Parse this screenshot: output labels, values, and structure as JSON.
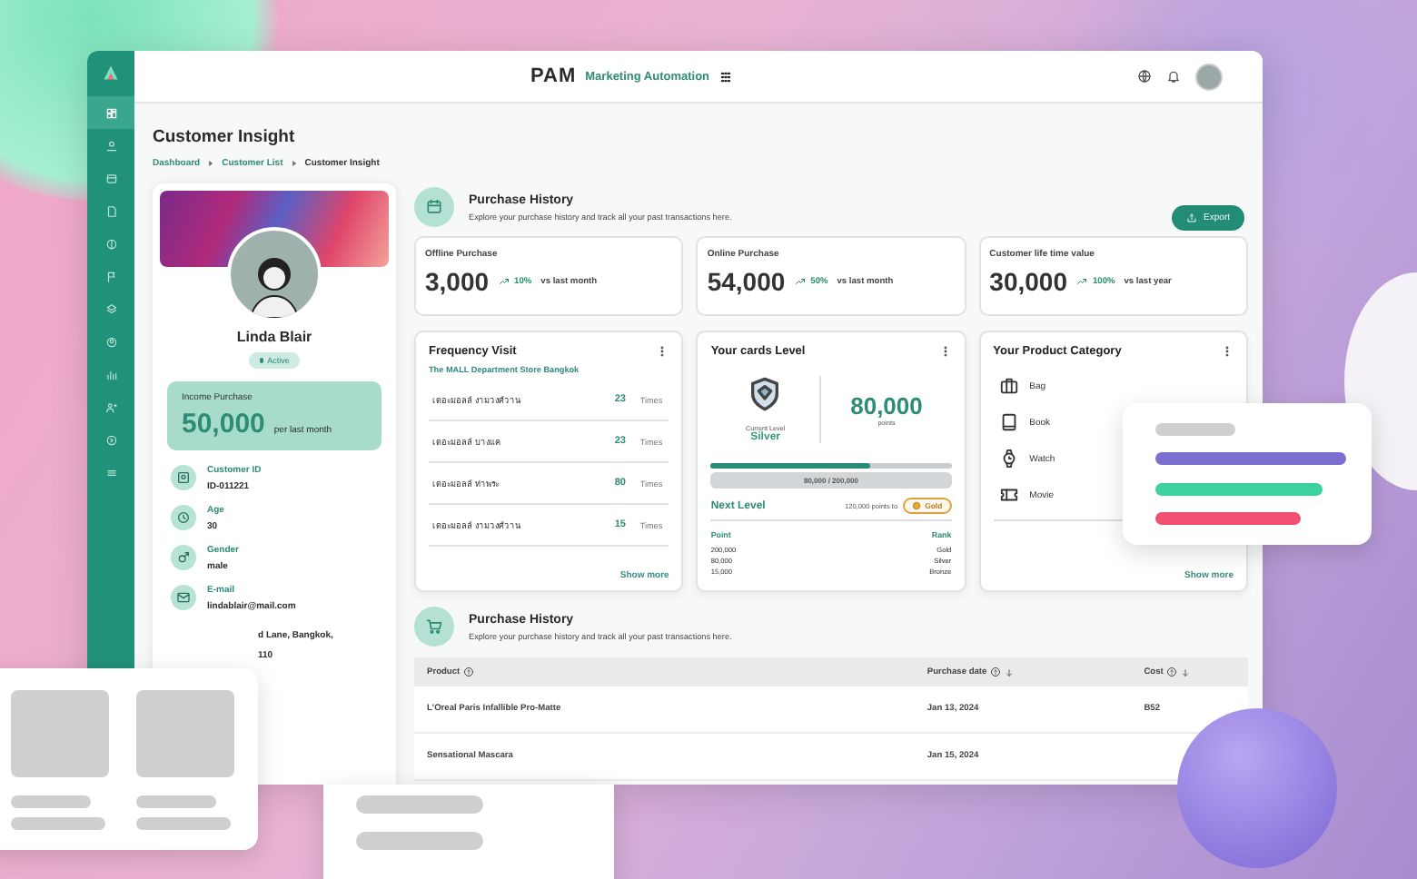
{
  "topbar": {
    "logo": "PAM",
    "product": "Marketing Automation"
  },
  "sidebar": {
    "items": [
      {
        "selected": true
      },
      {
        "selected": false
      },
      {
        "selected": false
      },
      {
        "selected": false
      },
      {
        "selected": false
      },
      {
        "selected": false
      },
      {
        "selected": false
      },
      {
        "selected": false
      },
      {
        "selected": false
      },
      {
        "selected": false
      },
      {
        "selected": false
      },
      {
        "selected": false
      }
    ]
  },
  "page": {
    "title": "Customer Insight",
    "breadcrumb": [
      "Dashboard",
      "Customer List",
      "Customer Insight"
    ]
  },
  "profile": {
    "name": "Linda Blair",
    "status": "Active",
    "active": true,
    "income_label": "Income Purchase",
    "income_value": "50,000",
    "income_period": "per last month",
    "fields": [
      {
        "kind": "id",
        "label": "Customer ID",
        "value": "ID-011221"
      },
      {
        "kind": "age",
        "label": "Age",
        "value": "30"
      },
      {
        "kind": "gender",
        "label": "Gender",
        "value": "male"
      },
      {
        "kind": "email",
        "label": "E-mail",
        "value": "lindablair@mail.com"
      }
    ],
    "address_lines": [
      "d Lane, Bangkok,",
      "110"
    ]
  },
  "summary": {
    "title": "Purchase History",
    "subtitle": "Explore your purchase history and track all your past transactions here.",
    "export": "Export"
  },
  "stats": [
    {
      "label": "Offline Purchase",
      "value": "3,000",
      "change": "10%",
      "compare": "vs last month"
    },
    {
      "label": "Online Purchase",
      "value": "54,000",
      "change": "50%",
      "compare": "vs last month"
    },
    {
      "label": "Customer life time value",
      "value": "30,000",
      "change": "100%",
      "compare": "vs last year"
    }
  ],
  "frequency": {
    "title": "Frequency Visit",
    "store": "The MALL Department Store Bangkok",
    "show_more": "Show more",
    "rows": [
      {
        "name": "เดอะมอลล์ งามวงศ์วาน",
        "count": "23",
        "unit": "Times"
      },
      {
        "name": "เดอะมอลล์ บางแค",
        "count": "23",
        "unit": "Times"
      },
      {
        "name": "เดอะมอลล์ ท่าพระ",
        "count": "80",
        "unit": "Times"
      },
      {
        "name": "เดอะมอลล์ งามวงศ์วาน",
        "count": "15",
        "unit": "Times"
      }
    ]
  },
  "cards_level": {
    "title": "Your cards Level",
    "current_label": "Current Level",
    "current": "Silver",
    "points": "80,000",
    "points_unit": "points",
    "level": 0.66,
    "progress_text": "80,000 / 200,000",
    "next_label": "Next Level",
    "to_next": "120,000 points to",
    "next": "Gold",
    "columns": [
      "Point",
      "Rank"
    ],
    "rows": [
      [
        "200,000",
        "Gold"
      ],
      [
        "80,000",
        "Silver"
      ],
      [
        "15,000",
        "Bronze"
      ]
    ]
  },
  "category": {
    "title": "Your Product Category",
    "show_more": "Show more",
    "items": [
      {
        "kind": "bag",
        "label": "Bag"
      },
      {
        "kind": "book",
        "label": "Book"
      },
      {
        "kind": "watch",
        "label": "Watch"
      },
      {
        "kind": "movie",
        "label": "Movie"
      }
    ]
  },
  "history": {
    "title": "Purchase History",
    "subtitle": "Explore your purchase history and track all your past transactions here.",
    "columns": [
      {
        "label": "Product",
        "sortable": false
      },
      {
        "label": "Purchase date",
        "sortable": true
      },
      {
        "label": "Cost",
        "sortable": true
      }
    ],
    "rows": [
      [
        "L'Oreal Paris Infallible Pro-Matte",
        "Jan 13, 2024",
        "B52"
      ],
      [
        "Sensational Mascara",
        "Jan 15, 2024",
        ""
      ]
    ]
  }
}
